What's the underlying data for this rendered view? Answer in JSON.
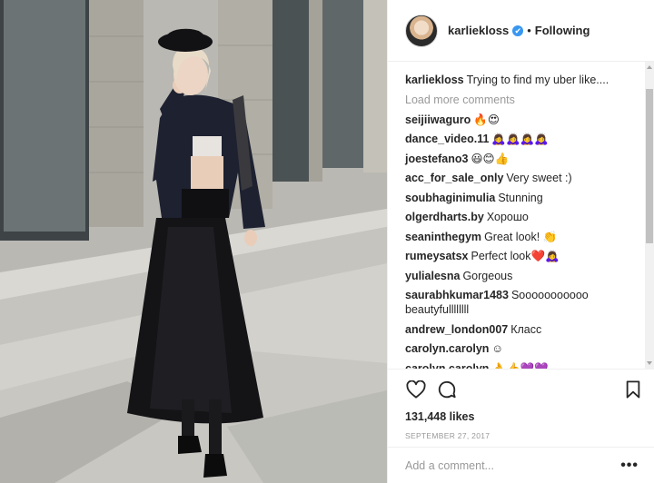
{
  "post": {
    "author": "karliekloss",
    "follow_status": "Following",
    "separator": "•",
    "verified_glyph": "✔",
    "caption_user": "karliekloss",
    "caption_text": "Trying to find my uber like....",
    "load_more_label": "Load more comments",
    "likes_text": "131,448 likes",
    "date_text": "September 27, 2017",
    "add_comment_placeholder": "Add a comment...",
    "more_options_label": "•••"
  },
  "comments": [
    {
      "user": "seijiiwaguro",
      "text": "🔥😍"
    },
    {
      "user": "dance_video.11",
      "text": "🙇‍♀️🙇‍♀️🙇‍♀️🙇‍♀️"
    },
    {
      "user": "joestefano3",
      "text": "😃😊👍"
    },
    {
      "user": "acc_for_sale_only",
      "text": "Very sweet :)"
    },
    {
      "user": "soubhaginimulia",
      "text": "Stunning"
    },
    {
      "user": "olgerdharts.by",
      "text": "Хорошо"
    },
    {
      "user": "seaninthegym",
      "text": "Great look! 👏"
    },
    {
      "user": "rumeysatsx",
      "text": "Perfect look❤️🙇‍♀️"
    },
    {
      "user": "yulialesna",
      "text": "Gorgeous"
    },
    {
      "user": "saurabhkumar1483",
      "text": "Sooooooooooo beautyfullllllll"
    },
    {
      "user": "andrew_london007",
      "text": "Класс"
    },
    {
      "user": "carolyn.carolyn",
      "text": "☺"
    },
    {
      "user": "carolyn.carolyn",
      "text": "👌👍💜💜"
    }
  ],
  "icons": {
    "heart": "heart-icon",
    "comment": "comment-icon",
    "bookmark": "bookmark-icon"
  },
  "colors": {
    "verified": "#3897f0",
    "text": "#262626",
    "muted": "#999999",
    "border": "#efefef"
  }
}
